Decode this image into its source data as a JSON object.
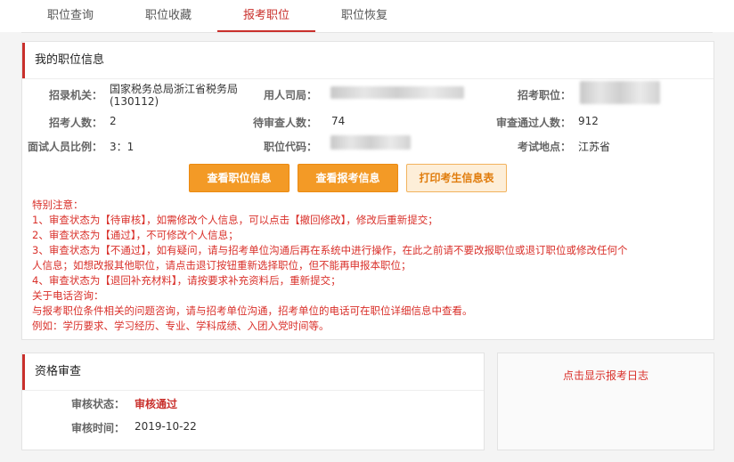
{
  "tabs": [
    "职位查询",
    "职位收藏",
    "报考职位",
    "职位恢复"
  ],
  "position_info": {
    "title": "我的职位信息",
    "recruit_org_label": "招录机关：",
    "recruit_org_value": "国家税务总局浙江省税务局",
    "recruit_org_code": "(130112)",
    "employer_label": "用人司局：",
    "position_label": "招考职位：",
    "headcount_label": "招考人数：",
    "headcount_value": "2",
    "pending_label": "待审查人数：",
    "pending_value": "74",
    "passed_label": "审查通过人数：",
    "passed_value": "912",
    "ratio_label": "面试人员比例：",
    "ratio_value": "3：1",
    "code_label": "职位代码：",
    "exam_site_label": "考试地点：",
    "exam_site_value": "江苏省"
  },
  "buttons": {
    "view_position": "查看职位信息",
    "view_application": "查看报考信息",
    "print_info": "打印考生信息表"
  },
  "notice_lines": [
    "特别注意：",
    "1、审查状态为【待审核】，如需修改个人信息，可以点击【撤回修改】，修改后重新提交；",
    "2、审查状态为【通过】，不可修改个人信息；",
    "3、审查状态为【不通过】，如有疑问，请与招考单位沟通后再在系统中进行操作，在此之前请不要改报职位或退订职位或修改任何个",
    "人信息；如想改报其他职位，请点击退订按钮重新选择职位，但不能再申报本职位；",
    "4、审查状态为【退回补充材料】，请按要求补充资料后，重新提交；",
    "关于电话咨询：",
    "与报考职位条件相关的问题咨询，请与招考单位沟通，招考单位的电话可在职位详细信息中查看。",
    "例如：学历要求、学习经历、专业、学科成绩、入团入党时间等。"
  ],
  "review": {
    "title": "资格审查",
    "status_label": "审核状态：",
    "status_value": "审核通过",
    "time_label": "审核时间：",
    "time_value": "2019-10-22"
  },
  "log_link": "点击显示报考日志",
  "colors": {
    "accent": "#c9302c",
    "button": "#f39a26",
    "notice": "#d9302a"
  }
}
